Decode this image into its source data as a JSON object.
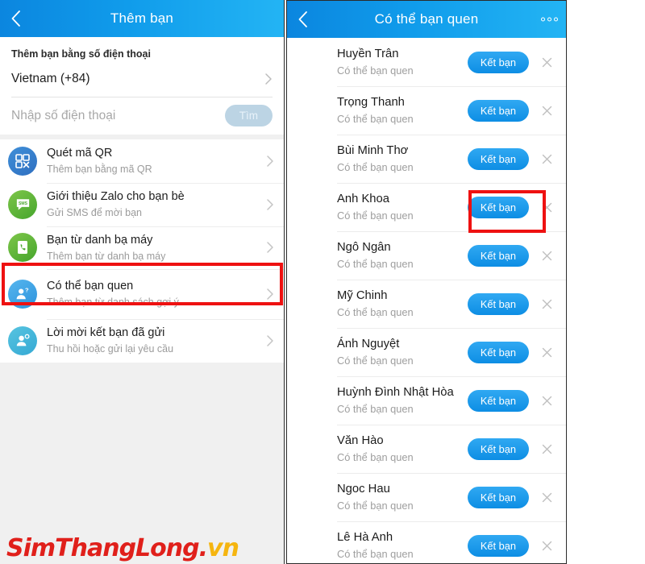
{
  "left_panel": {
    "header": {
      "title": "Thêm bạn",
      "back_icon": "chevron-left-icon"
    },
    "phone_section": {
      "label": "Thêm bạn bằng số điện thoại",
      "country": "Vietnam (+84)",
      "country_chevron": "chevron-right-icon",
      "phone_placeholder": "Nhập số điện thoại",
      "phone_value": "",
      "find_label": "Tìm"
    },
    "options": [
      {
        "icon": "qr-code-icon",
        "title": "Quét mã QR",
        "subtitle": "Thêm bạn bằng mã QR",
        "chevron": "chevron-right-icon"
      },
      {
        "icon": "sms-bubble-icon",
        "title": "Giới thiệu Zalo cho bạn bè",
        "subtitle": "Gửi SMS để mời bạn",
        "chevron": "chevron-right-icon"
      },
      {
        "icon": "phone-contact-icon",
        "title": "Bạn từ danh bạ máy",
        "subtitle": "Thêm bạn từ danh bạ máy",
        "chevron": "chevron-right-icon"
      },
      {
        "icon": "person-question-icon",
        "title": "Có thể bạn quen",
        "subtitle": "Thêm bạn từ danh sách gợi ý",
        "chevron": "chevron-right-icon"
      },
      {
        "icon": "person-plus-icon",
        "title": "Lời mời kết bạn đã gửi",
        "subtitle": "Thu hồi hoặc gửi lại yêu cầu",
        "chevron": "chevron-right-icon"
      }
    ]
  },
  "right_panel": {
    "header": {
      "title": "Có thể bạn quen",
      "back_icon": "chevron-left-icon",
      "more_icon": "more-horizontal-icon"
    },
    "add_label": "Kết bạn",
    "dismiss_icon": "close-icon",
    "suggestions": [
      {
        "name": "Huyền Trân",
        "subtitle": "Có thể bạn quen"
      },
      {
        "name": "Trọng Thanh",
        "subtitle": "Có thể bạn quen"
      },
      {
        "name": "Bùi Minh Thơ",
        "subtitle": "Có thể bạn quen"
      },
      {
        "name": "Anh Khoa",
        "subtitle": "Có thể bạn quen"
      },
      {
        "name": "Ngô Ngân",
        "subtitle": "Có thể bạn quen"
      },
      {
        "name": "Mỹ Chinh",
        "subtitle": "Có thể bạn quen"
      },
      {
        "name": "Ánh Nguyệt",
        "subtitle": "Có thể bạn quen"
      },
      {
        "name": "Huỳnh Đình Nhật Hòa",
        "subtitle": "Có thể bạn quen"
      },
      {
        "name": "Văn Hào",
        "subtitle": "Có thể bạn quen"
      },
      {
        "name": "Ngoc Hau",
        "subtitle": "Có thể bạn quen"
      },
      {
        "name": "Lê Hà Anh",
        "subtitle": "Có thể bạn quen"
      }
    ]
  },
  "annotations": {
    "left_highlight_target": "Có thể bạn quen",
    "right_highlight_target": "Kết bạn",
    "highlight_color": "#ee1111"
  },
  "watermark": {
    "primary": "SimThangLong.",
    "suffix": "vn",
    "primary_color": "#e0201b",
    "suffix_color": "#f5b510"
  }
}
